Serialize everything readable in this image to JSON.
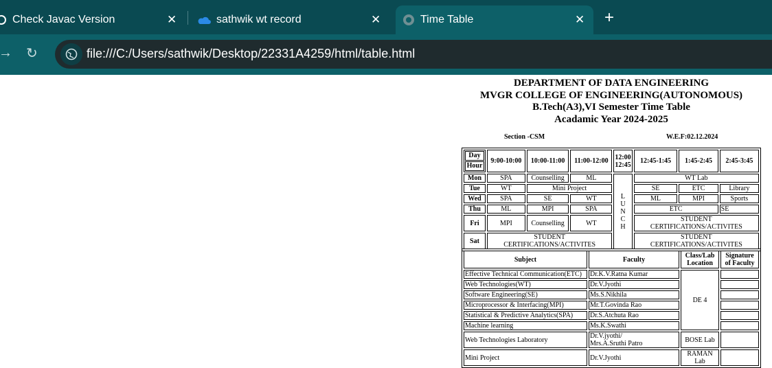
{
  "browser": {
    "tabs": [
      {
        "title": "Check Javac Version",
        "icon": "openai-icon"
      },
      {
        "title": "sathwik wt record",
        "icon": "onedrive-cloud-icon"
      },
      {
        "title": "Time Table",
        "icon": "globe-icon",
        "active": true
      }
    ],
    "url": "file:///C:/Users/sathwik/Desktop/22331A4259/html/table.html",
    "colors": {
      "tabbar": "#0a4a52",
      "active_tab": "#0d6068",
      "urlbar": "#1f2b2e"
    }
  },
  "page": {
    "heading": [
      "DEPARTMENT OF DATA ENGINEERING",
      "MVGR COLLEGE OF ENGINEERING(AUTONOMOUS)",
      "B.Tech(A3),VI Semester Time Table",
      "Acadamic Year 2024-2025"
    ],
    "section": "Section -CSM",
    "wef": "W.E.F:02.12.2024",
    "timetable": {
      "day_label": "Day",
      "hour_label": "Hour",
      "slots": [
        "9:00-10:00",
        "10:00-11:00",
        "11:00-12:00",
        "12:00 12:45",
        "12:45-1:45",
        "1:45-2:45",
        "2:45-3:45"
      ],
      "lunch": "LUNCH",
      "rows": {
        "mon": {
          "day": "Mon",
          "s1": "SPA",
          "s2": "Counselling",
          "s3": "ML",
          "pm": "WT Lab"
        },
        "tue": {
          "day": "Tue",
          "s1": "WT",
          "s23": "Mini Project",
          "s5": "SE",
          "s6": "ETC",
          "s7": "Library"
        },
        "wed": {
          "day": "Wed",
          "s1": "SPA",
          "s2": "SE",
          "s3": "WT",
          "s5": "ML",
          "s6": "MPI",
          "s7": "Sports"
        },
        "thu": {
          "day": "Thu",
          "s1": "ML",
          "s2": "MPI",
          "s3": "SPA",
          "s56": "ETC",
          "s7": "SE"
        },
        "fri": {
          "day": "Fri",
          "s1": "MPI",
          "s2": "Counselling",
          "s3": "WT",
          "pm": "STUDENT CERTIFICATIONS/ACTIVITES"
        },
        "sat": {
          "day": "Sat",
          "am": "STUDENT CERTIFICATIONS/ACTIVITES",
          "pm": "STUDENT CERTIFICATIONS/ACTIVITES"
        }
      }
    },
    "faculty_table": {
      "headers": {
        "subject": "Subject",
        "faculty": "Faculty",
        "location": "Class/Lab Location",
        "signature": "Signature of Faculty"
      },
      "rows": [
        {
          "subject": "Effective Technical Communication(ETC)",
          "faculty": "Dr.K.V.Ratna Kumar"
        },
        {
          "subject": "Web Technologies(WT)",
          "faculty": "Dr.V.Jyothi"
        },
        {
          "subject": "Software Engineering(SE)",
          "faculty": "Ms.S.Nikhila"
        },
        {
          "subject": "Microprocessor & Interfacing(MPI)",
          "faculty": "Mr.T.Govinda Rao"
        },
        {
          "subject": "Statistical & Predictive Analytics(SPA)",
          "faculty": "Dr.S.Atchuta Rao"
        },
        {
          "subject": "Machine learning",
          "faculty": "Ms.K.Swathi"
        },
        {
          "subject": "Web Technologies Laboratory",
          "faculty": "Dr.V.jyothi/",
          "faculty2": "Mrs.A.Sruthi Patro"
        },
        {
          "subject": "Mini Project",
          "faculty": "Dr.V.Jyothi"
        }
      ],
      "de4": "DE 4",
      "bose": "BOSE Lab",
      "raman": "RAMAN Lab"
    }
  }
}
